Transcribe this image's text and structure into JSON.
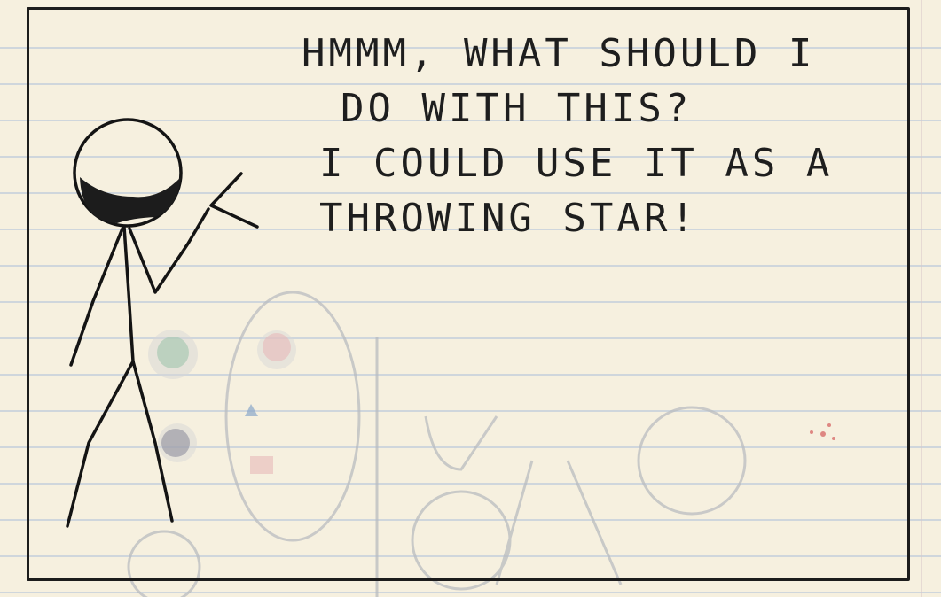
{
  "comic": {
    "speech_lines": [
      "HMMM, WHAT SHOULD I",
      "DO WITH THIS?",
      "I COULD USE IT AS A",
      "THROWING STAR!"
    ]
  },
  "colors": {
    "paper": "#f6f0df",
    "ink": "#1c1c1c",
    "rule_line": "#cfd6dc",
    "ghost_ink": "#b9bcc0"
  }
}
